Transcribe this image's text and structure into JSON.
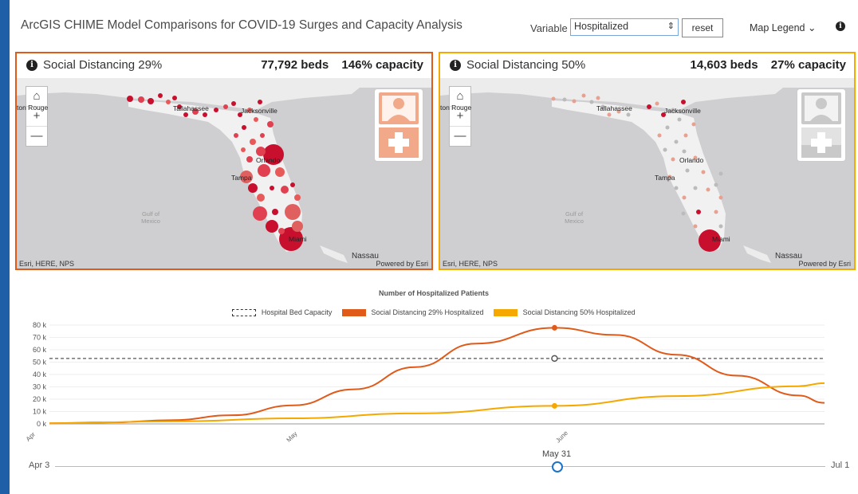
{
  "header": {
    "title": "ArcGIS CHIME Model Comparisons for COVID-19 Surges and Capacity Analysis",
    "variable_label": "Variable",
    "variable_value": "Hospitalized",
    "reset_label": "reset",
    "map_legend_label": "Map Legend ⌄",
    "info_glyph": "i"
  },
  "maps": [
    {
      "title": "Social Distancing 29%",
      "beds": "77,792 beds",
      "capacity": "146% capacity",
      "accent": "#e05a1a",
      "icon_fill": "#f2a98a",
      "places": [
        "Tallahassee",
        "Jacksonville",
        "Orlando",
        "Tampa",
        "Miami"
      ],
      "edge_label": "ton Rouge",
      "gulf_label": "Gulf of\nMexico",
      "nassau_label": "Nassau",
      "attribution": "Esri, HERE, NPS",
      "powered_by": "Powered by Esri",
      "zoom_home": "⌂",
      "zoom_in": "+",
      "zoom_out": "—"
    },
    {
      "title": "Social Distancing 50%",
      "beds": "14,603 beds",
      "capacity": "27% capacity",
      "accent": "#f5a800",
      "icon_fill": "#c9c9c9",
      "places": [
        "Tallahassee",
        "Jacksonville",
        "Orlando",
        "Tampa",
        "Miami"
      ],
      "edge_label": "ton Rouge",
      "gulf_label": "Gulf of\nMexico",
      "nassau_label": "Nassau",
      "attribution": "Esri, HERE, NPS",
      "powered_by": "Powered by Esri",
      "zoom_home": "⌂",
      "zoom_in": "+",
      "zoom_out": "—"
    }
  ],
  "chart_data": {
    "type": "line",
    "title": "Number of Hospitalized Patients",
    "x_ticks": [
      "Apr",
      "May",
      "June"
    ],
    "y_ticks": [
      "0 k",
      "10 k",
      "20 k",
      "30 k",
      "40 k",
      "50 k",
      "60 k",
      "70 k",
      "80 k"
    ],
    "ylim": [
      0,
      80000
    ],
    "xlim": [
      "2020-04-03",
      "2020-07-01"
    ],
    "series": [
      {
        "name": "Hospital Bed Capacity",
        "color": "#555555",
        "dashed": true,
        "x": [
          "2020-04-03",
          "2020-07-01"
        ],
        "values": [
          53000,
          53000
        ]
      },
      {
        "name": "Social Distancing 29% Hospitalized",
        "color": "#e05a1a",
        "x": [
          "2020-04-03",
          "2020-04-10",
          "2020-04-17",
          "2020-04-24",
          "2020-05-01",
          "2020-05-08",
          "2020-05-15",
          "2020-05-22",
          "2020-05-31",
          "2020-06-07",
          "2020-06-14",
          "2020-06-21",
          "2020-06-28",
          "2020-07-01"
        ],
        "values": [
          500,
          1200,
          3000,
          7000,
          15000,
          28000,
          46000,
          65000,
          77792,
          72000,
          56000,
          39000,
          23000,
          17000
        ]
      },
      {
        "name": "Social Distancing 50% Hospitalized",
        "color": "#f5a800",
        "x": [
          "2020-04-03",
          "2020-04-17",
          "2020-05-01",
          "2020-05-15",
          "2020-05-31",
          "2020-06-14",
          "2020-06-28",
          "2020-07-01"
        ],
        "values": [
          500,
          2000,
          4500,
          8500,
          14603,
          22500,
          30500,
          33000
        ]
      }
    ],
    "highlight_x": "2020-05-31"
  },
  "slider": {
    "start_label": "Apr 3",
    "end_label": "Jul 1",
    "current_label": "May 31",
    "current_fraction": 0.66
  }
}
